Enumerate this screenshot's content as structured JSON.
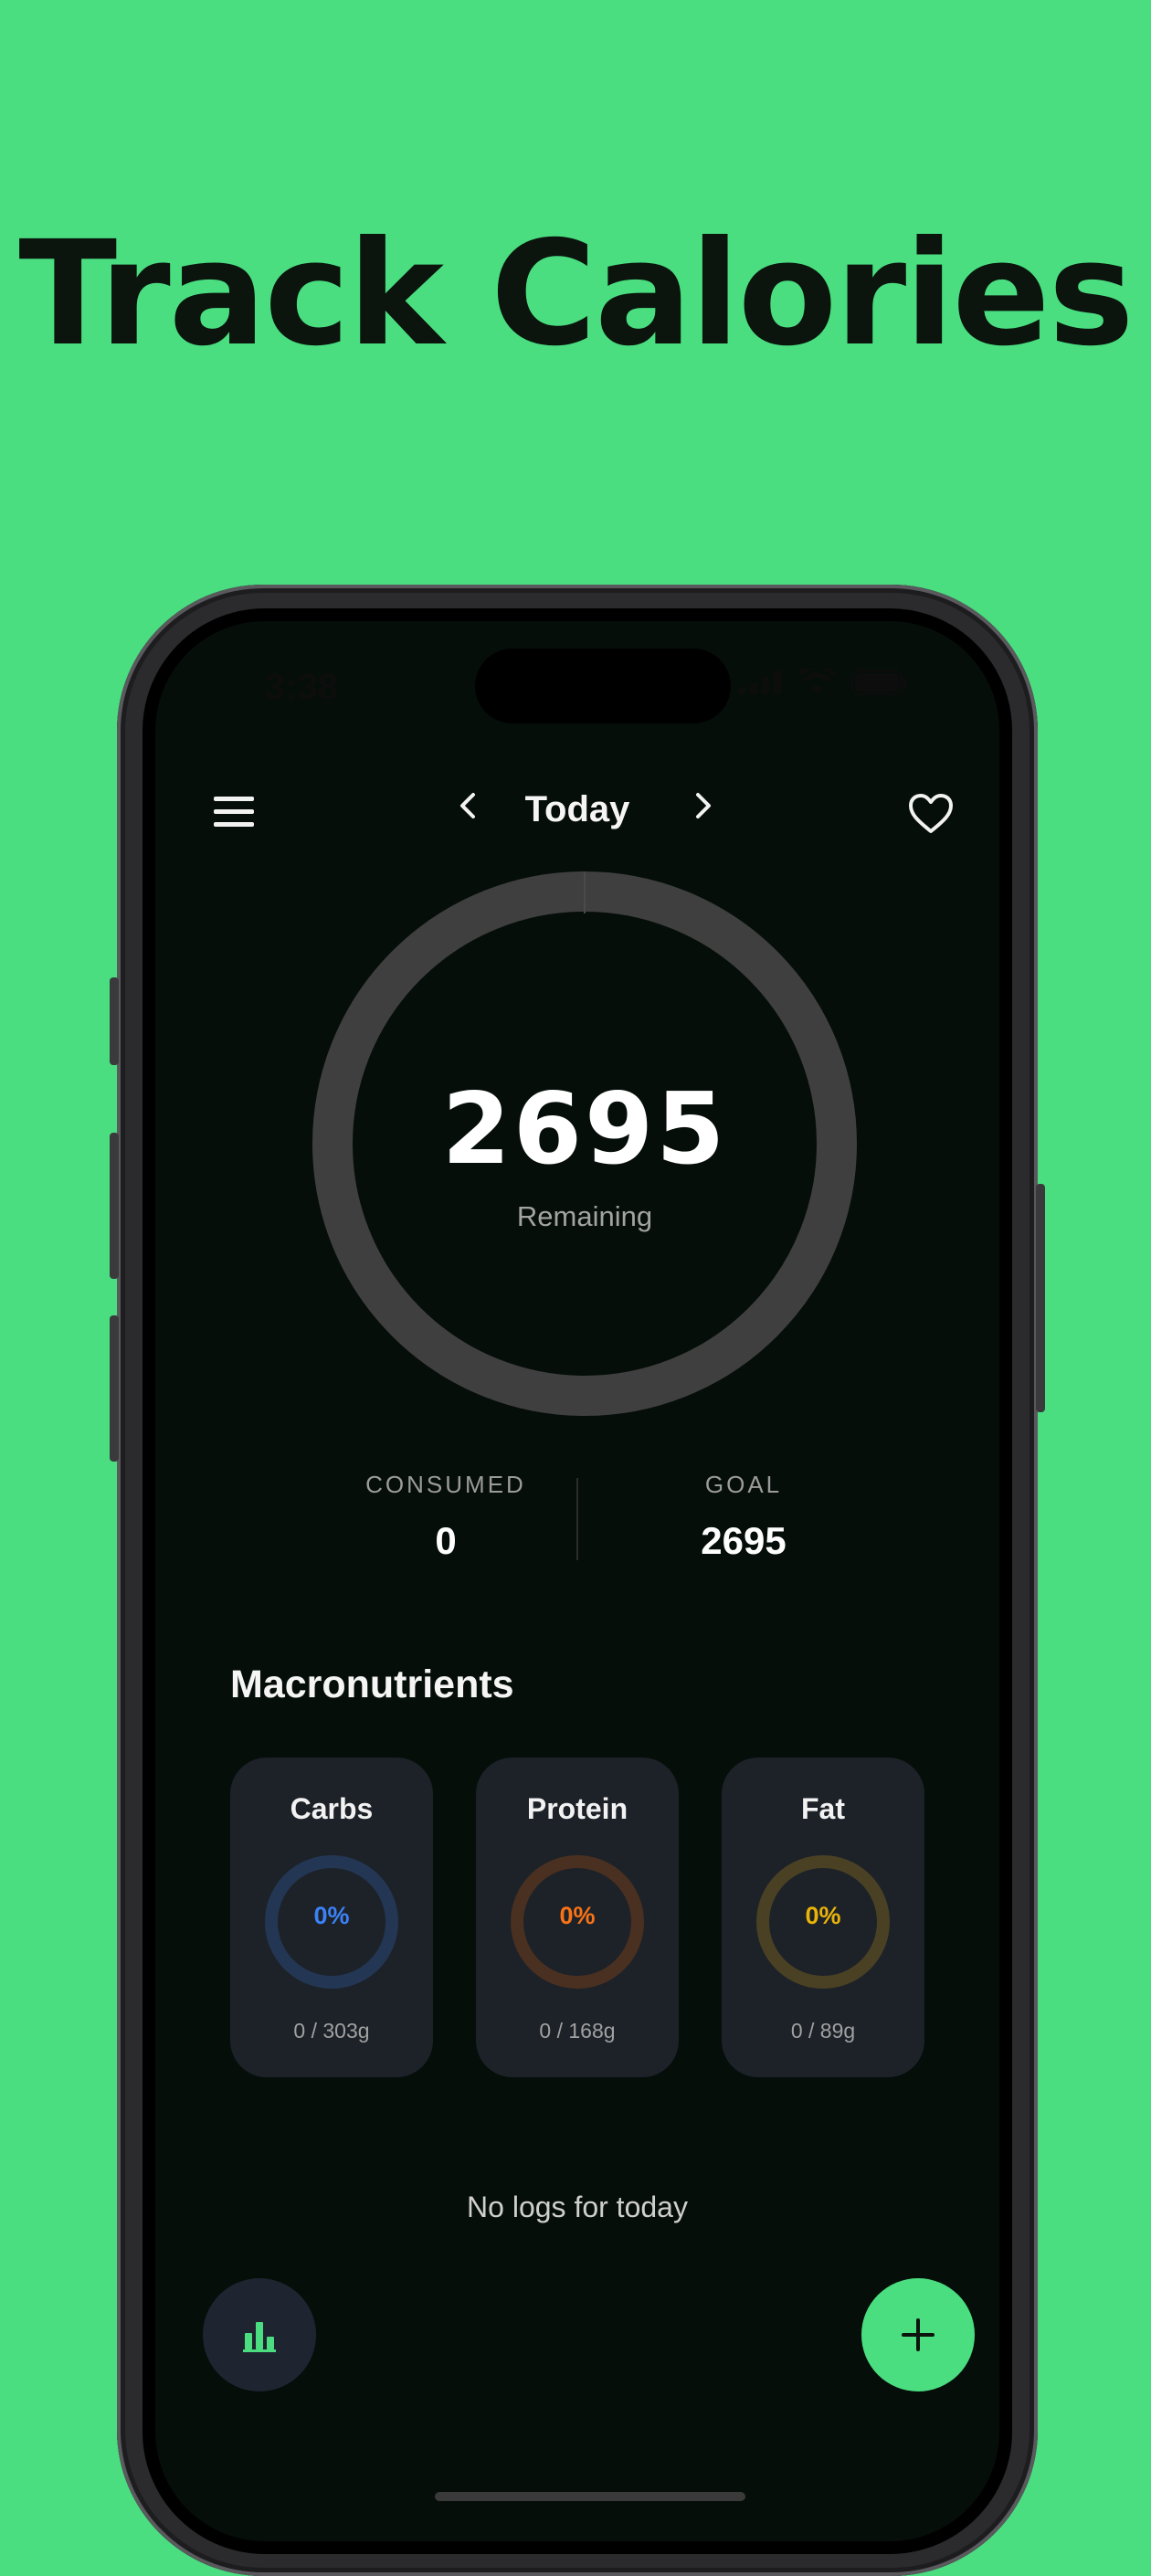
{
  "colors": {
    "background": "#4ade80",
    "screen": "#060e0a",
    "accent": "#4ade80",
    "carbs": "#3b82f6",
    "protein": "#f97316",
    "fat": "#eab308"
  },
  "headline": "Track Calories",
  "status": {
    "time": "3:38",
    "icons": [
      "signal-icon",
      "wifi-icon",
      "battery-icon"
    ]
  },
  "topbar": {
    "title": "Today",
    "prev_icon": "chevron-left-icon",
    "next_icon": "chevron-right-icon",
    "menu_icon": "menu-icon",
    "favorite_icon": "heart-icon"
  },
  "calories": {
    "remaining": "2695",
    "remaining_label": "Remaining",
    "progress": 0
  },
  "stats": {
    "consumed_label": "CONSUMED",
    "consumed_value": "0",
    "goal_label": "GOAL",
    "goal_value": "2695"
  },
  "macros": {
    "title": "Macronutrients",
    "items": [
      {
        "name": "Carbs",
        "percent": "0%",
        "amount": "0 / 303g"
      },
      {
        "name": "Protein",
        "percent": "0%",
        "amount": "0 / 168g"
      },
      {
        "name": "Fat",
        "percent": "0%",
        "amount": "0 / 89g"
      }
    ]
  },
  "empty_message": "No logs for today",
  "actions": {
    "stats_icon": "bar-chart-icon",
    "add_icon": "plus-icon"
  }
}
